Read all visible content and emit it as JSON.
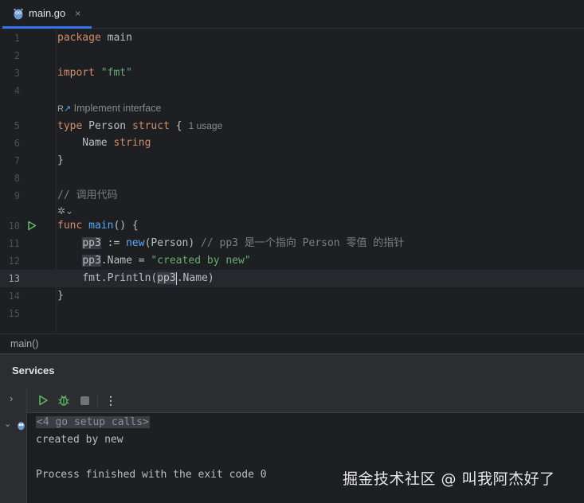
{
  "tab": {
    "filename": "main.go",
    "close": "×"
  },
  "editor": {
    "lines": [
      {
        "n": "1"
      },
      {
        "n": "2"
      },
      {
        "n": "3"
      },
      {
        "n": "4"
      },
      {
        "n": "5"
      },
      {
        "n": "6"
      },
      {
        "n": "7"
      },
      {
        "n": "8"
      },
      {
        "n": "9"
      },
      {
        "n": "10"
      },
      {
        "n": "11"
      },
      {
        "n": "12"
      },
      {
        "n": "13"
      },
      {
        "n": "14"
      },
      {
        "n": "15"
      }
    ],
    "code": {
      "l1_kw": "package",
      "l1_rest": " main",
      "l3_kw": "import",
      "l3_str": "\"fmt\"",
      "hint_impl": "Implement interface",
      "l5_kw": "type",
      "l5_name": " Person ",
      "l5_kw2": "struct",
      "l5_brace": " {",
      "l5_usage": "1 usage",
      "l6_field": "    Name ",
      "l6_type": "string",
      "l7": "}",
      "l9_comment": "// 调用代码",
      "l10_kw": "func",
      "l10_fn": "main",
      "l10_rest": "() {",
      "l11_indent": "    ",
      "l11_var": "pp3",
      "l11_op": " := ",
      "l11_new": "new",
      "l11_args": "(Person) ",
      "l11_comment": "// pp3 是一个指向 Person 零值 的指针",
      "l12_indent": "    ",
      "l12_var": "pp3",
      "l12_rest": ".Name = ",
      "l12_str": "\"created by new\"",
      "l13_indent": "    ",
      "l13_pre": "fmt.Println(",
      "l13_var": "pp3",
      "l13_post": ".Name)",
      "l14": "}"
    }
  },
  "breadcrumb": "main()",
  "services": {
    "title": "Services",
    "console": {
      "setup": "<4 go setup calls>",
      "line1": "created by new",
      "line2": "Process finished with the exit code 0"
    }
  },
  "watermark": "掘金技术社区 @ 叫我阿杰好了",
  "colors": {
    "accent": "#3574f0",
    "run": "#5fb865",
    "keyword": "#cf8e6d",
    "string": "#6aab73"
  }
}
